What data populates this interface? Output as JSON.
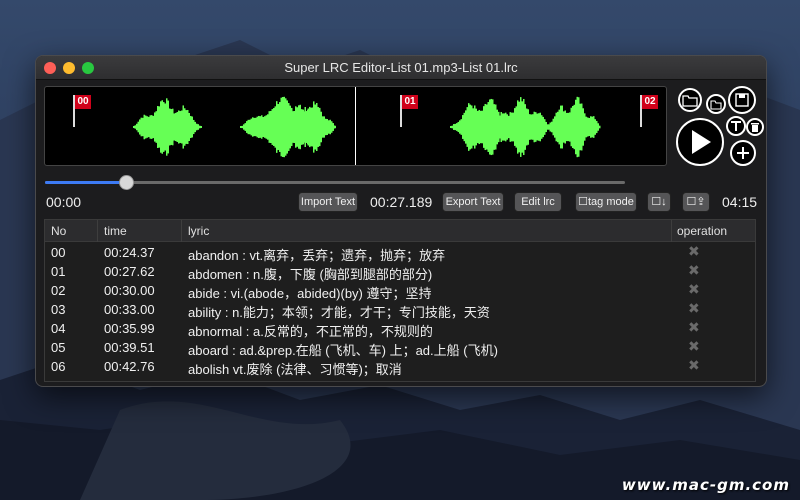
{
  "window": {
    "title": "Super LRC Editor-List 01.mp3-List 01.lrc"
  },
  "waveform": {
    "color": "#66ff55",
    "markers": [
      {
        "label": "00"
      },
      {
        "label": "01"
      },
      {
        "label": "02"
      }
    ]
  },
  "playback": {
    "start_time": "00:00",
    "current_time": "00:27.189",
    "end_time": "04:15",
    "progress": 0.14
  },
  "toolbar": {
    "import_label": "Import Text",
    "export_label": "Export Text",
    "edit_label": "Edit lrc",
    "tag_mode_label": "☐tag mode",
    "sort_label": "☐↓",
    "shift_label": "☐⇪"
  },
  "table": {
    "headers": {
      "no": "No",
      "time": "time",
      "lyric": "lyric",
      "operation": "operation"
    },
    "rows": [
      {
        "no": "00",
        "time": "00:24.37",
        "lyric": "abandon : vt.离弃，丢弃；遗弃，抛弃；放弃"
      },
      {
        "no": "01",
        "time": "00:27.62",
        "lyric": "abdomen : n.腹，下腹 (胸部到腿部的部分)"
      },
      {
        "no": "02",
        "time": "00:30.00",
        "lyric": "abide : vi.(abode，abided)(by) 遵守；坚持"
      },
      {
        "no": "03",
        "time": "00:33.00",
        "lyric": "ability : n.能力；本领；才能，才干；专门技能，天资"
      },
      {
        "no": "04",
        "time": "00:35.99",
        "lyric": "abnormal : a.反常的，不正常的，不规则的"
      },
      {
        "no": "05",
        "time": "00:39.51",
        "lyric": "aboard : ad.&prep.在船 (飞机、车) 上；ad.上船 (飞机)"
      },
      {
        "no": "06",
        "time": "00:42.76",
        "lyric": "abolish    vt.废除 (法律、习惯等)；取消"
      }
    ]
  },
  "watermark": "www.mac-gm.com"
}
